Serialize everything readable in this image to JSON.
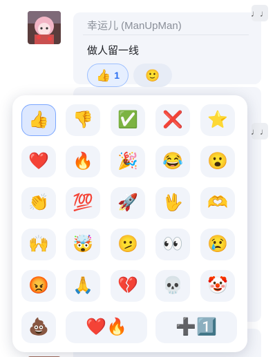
{
  "message": {
    "sender": "幸运儿 (ManUpMan)",
    "text": "做人留一线",
    "reactions": [
      {
        "emoji": "👍",
        "count": "1",
        "active": true
      },
      {
        "emoji": "🙂",
        "count": "",
        "active": false
      }
    ]
  },
  "corner_icon_glyph": "♩♩",
  "emoji_picker": {
    "rows": [
      [
        "👍",
        "👎",
        "✅",
        "❌",
        "⭐"
      ],
      [
        "❤️",
        "🔥",
        "🎉",
        "😂",
        "😮"
      ],
      [
        "👏",
        "💯",
        "🚀",
        "🖖",
        "🫶"
      ],
      [
        "🙌",
        "🤯",
        "🫤",
        "👀",
        "😢"
      ],
      [
        "😡",
        "🙏",
        "💔",
        "💀",
        "🤡"
      ]
    ],
    "last_row": [
      "💩",
      "❤️🔥",
      "➕1️⃣"
    ]
  },
  "colors": {
    "accent": "#2a6ef0",
    "selected_border": "#7aa6ff",
    "cell_bg": "#f1f4fa"
  }
}
